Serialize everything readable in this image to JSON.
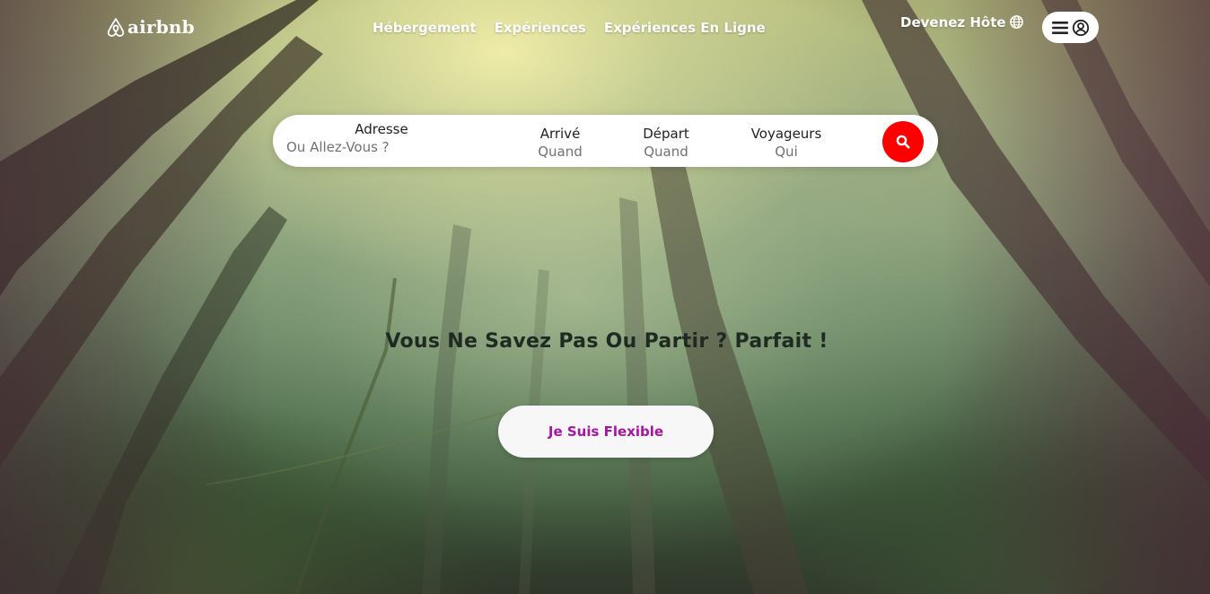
{
  "brand": {
    "logo_text": "airbnb",
    "accent_color": "#ff0000",
    "flex_button_color": "#a3179f"
  },
  "nav": {
    "links": [
      "Hébergement",
      "Expériences",
      "Expériences En Ligne"
    ],
    "host_link": "Devenez Hôte",
    "globe_icon": "globe-icon",
    "menu_icons": [
      "hamburger-icon",
      "user-circle-icon"
    ]
  },
  "search": {
    "address": {
      "label": "Adresse",
      "value": "Ou Allez-Vous ?"
    },
    "arrival": {
      "label": "Arrivé",
      "value": "Quand"
    },
    "departure": {
      "label": "Départ",
      "value": "Quand"
    },
    "travelers": {
      "label": "Voyageurs",
      "value": "Qui"
    },
    "button_icon": "search-icon"
  },
  "hero": {
    "headline": "Vous Ne Savez Pas Ou Partir ? Parfait !",
    "flexible_button": "Je Suis Flexible"
  }
}
